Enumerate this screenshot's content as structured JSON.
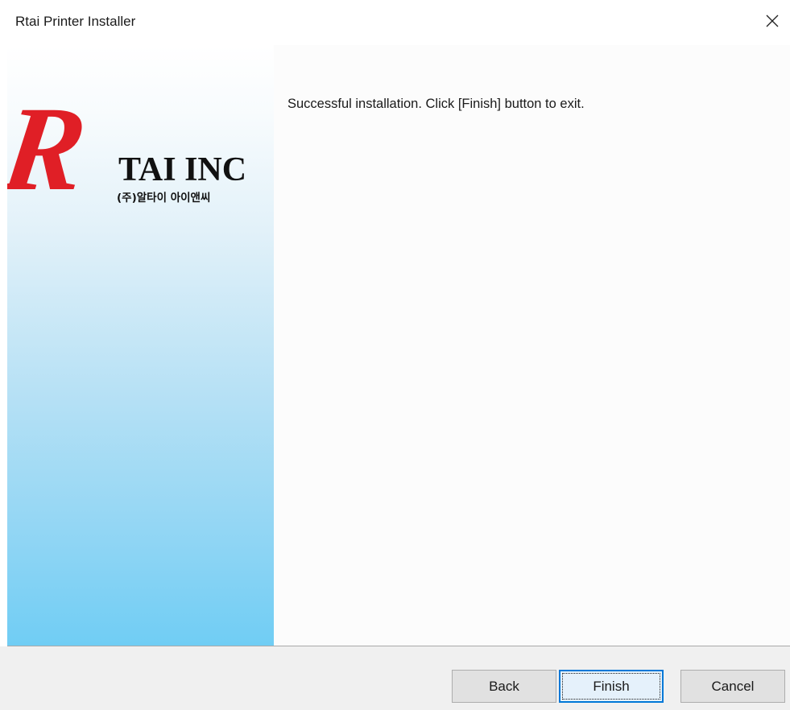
{
  "window": {
    "title": "Rtai Printer Installer",
    "close_icon": "close-icon"
  },
  "logo": {
    "letter": "R",
    "company": "TAI INC",
    "korean_name": "(주)알타이 아이앤씨",
    "brand_red": "#e01f26"
  },
  "main": {
    "message": "Successful installation. Click [Finish] button to exit."
  },
  "buttons": {
    "back": "Back",
    "finish": "Finish",
    "cancel": "Cancel"
  },
  "colors": {
    "accent": "#0078d7",
    "panel_gradient_bottom": "#70cdf4"
  }
}
